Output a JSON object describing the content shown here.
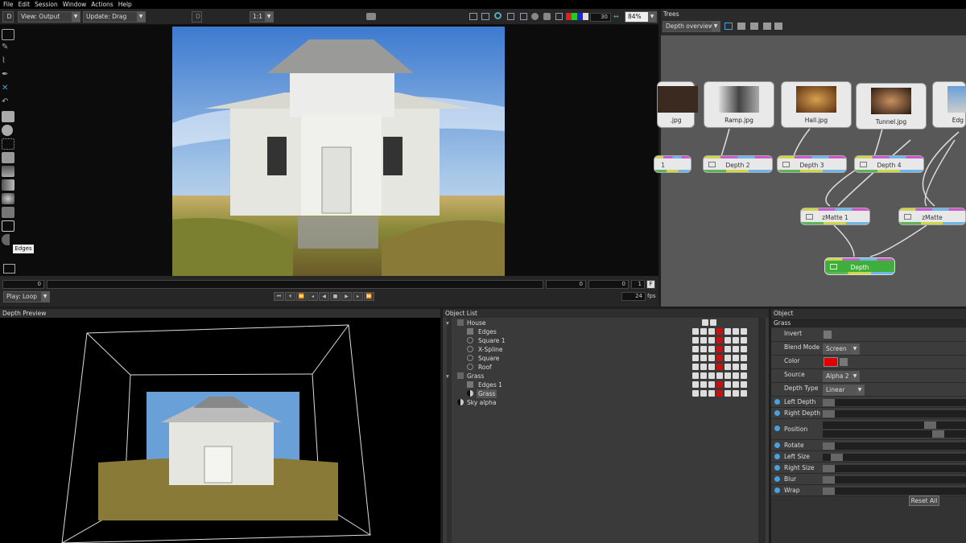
{
  "menu": [
    "File",
    "Edit",
    "Session",
    "Window",
    "Actions",
    "Help"
  ],
  "viewer": {
    "view_select": "View: Output",
    "update_select": "Update: Drag",
    "ratio_select": "1:1",
    "counter": "30",
    "zoom": "84%",
    "tooltip": "Edges",
    "frame_start": "0",
    "frame_a": "0",
    "frame_b": "0",
    "frame_c": "1",
    "frame_f": "F",
    "play_mode": "Play: Loop",
    "fps_value": "24",
    "fps_unit": "fps"
  },
  "trees": {
    "title": "Trees",
    "select": "Depth overview",
    "image_nodes": [
      ".jpg",
      "Ramp.jpg",
      "Hall.jpg",
      "Tunnel.jpg",
      "Edg"
    ],
    "process_nodes": [
      "1",
      "Depth 2",
      "Depth 3",
      "Depth 4",
      "zMatte 1",
      "zMatte",
      "Depth"
    ]
  },
  "depth_preview": {
    "title": "Depth Preview"
  },
  "object_list": {
    "title": "Object List",
    "rows": [
      {
        "label": "House",
        "indent": 0
      },
      {
        "label": "Edges",
        "indent": 1
      },
      {
        "label": "Square 1",
        "indent": 1
      },
      {
        "label": "X-Spline",
        "indent": 1
      },
      {
        "label": "Square",
        "indent": 1
      },
      {
        "label": "Roof",
        "indent": 1
      },
      {
        "label": "Grass",
        "indent": 0
      },
      {
        "label": "Edges 1",
        "indent": 1
      },
      {
        "label": "Grass",
        "indent": 1
      },
      {
        "label": "Sky alpha",
        "indent": 0
      }
    ]
  },
  "object": {
    "title": "Object",
    "name": "Grass",
    "invert_label": "Invert",
    "blend_label": "Blend Mode",
    "blend_value": "Screen",
    "color_label": "Color",
    "color_value": "#e00000",
    "source_label": "Source",
    "source_value": "Alpha 2",
    "depth_type_label": "Depth Type",
    "depth_type_value": "Linear",
    "sliders": [
      "Left Depth",
      "Right Depth",
      "Position",
      "",
      "Rotate",
      "Left Size",
      "Right Size",
      "Blur",
      "Wrap"
    ],
    "reset": "Reset All"
  },
  "colors": {
    "accent": "#4aa0d8",
    "node_green": "#3fae3a",
    "red": "#c81010"
  }
}
